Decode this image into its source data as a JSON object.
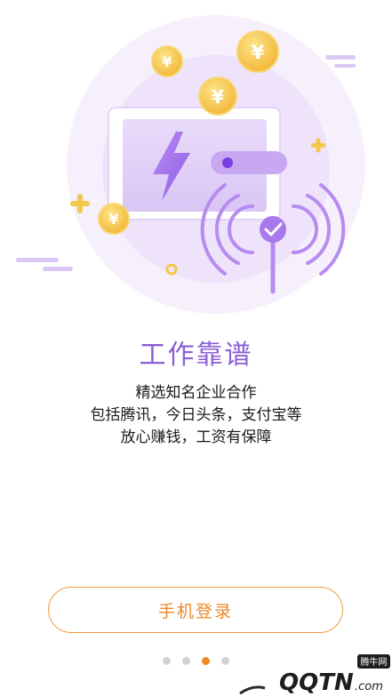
{
  "slide": {
    "title": "工作靠谱",
    "description_lines": [
      "精选知名企业合作",
      "包括腾讯，今日头条，支付宝等",
      "放心赚钱，工资有保障"
    ]
  },
  "actions": {
    "login_label": "手机登录"
  },
  "pager": {
    "total": 4,
    "active_index": 2
  },
  "illustration": {
    "coin_symbol": "¥",
    "icons": [
      "wallet-icon",
      "lightning-icon",
      "signal-icon",
      "check-icon",
      "coin-icon",
      "plus-icon"
    ]
  },
  "watermark": {
    "brand": "QQTN.com",
    "tag": "腾牛网"
  },
  "colors": {
    "accent_purple": "#8b5fd6",
    "accent_orange": "#f08a24",
    "coin_gold": "#f5c542"
  }
}
